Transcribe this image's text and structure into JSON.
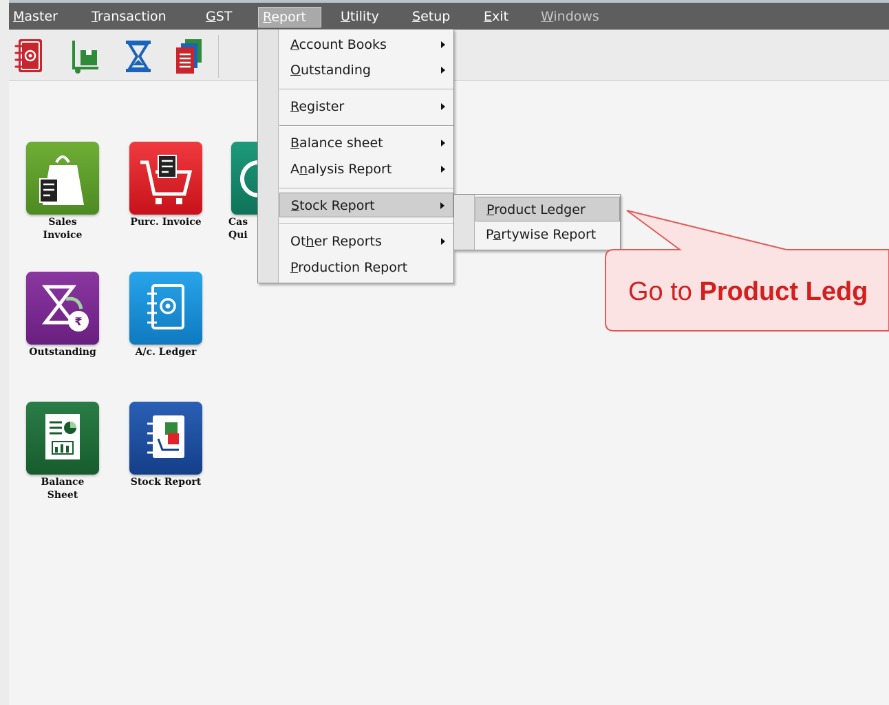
{
  "menubar": {
    "items": [
      {
        "label": "Master",
        "key": "M",
        "rest": "aster"
      },
      {
        "label": "Transaction",
        "key": "T",
        "rest": "ransaction"
      },
      {
        "label": "GST",
        "key": "G",
        "rest": "ST"
      },
      {
        "label": "Report",
        "key": "R",
        "rest": "eport"
      },
      {
        "label": "Utility",
        "key": "U",
        "rest": "tility"
      },
      {
        "label": "Setup",
        "key": "S",
        "rest": "etup"
      },
      {
        "label": "Exit",
        "key": "E",
        "rest": "xit"
      },
      {
        "label": "Windows",
        "key": "W",
        "rest": "indows"
      }
    ],
    "open_item": "Report"
  },
  "toolbar": {
    "icons": [
      "ledger-book-icon",
      "stock-trolley-icon",
      "hourglass-icon",
      "documents-icon"
    ]
  },
  "tiles": [
    {
      "label_line1": "Sales",
      "label_line2": "Invoice",
      "color": "#5b9a2c",
      "icon": "shopping-bag-icon"
    },
    {
      "label_line1": "Purc. Invoice",
      "label_line2": "",
      "color": "#e0232b",
      "icon": "shopping-cart-icon"
    },
    {
      "label_line1": "Cas",
      "label_line2": "Qui",
      "color": "#168a6e",
      "icon": "cash-icon"
    },
    {
      "label_line1": "Outstanding",
      "label_line2": "",
      "color": "#7a2b8e",
      "icon": "hourglass-rupee-icon"
    },
    {
      "label_line1": "A/c. Ledger",
      "label_line2": "",
      "color": "#1a8fd6",
      "icon": "ledger-book-icon"
    },
    {
      "label_line1": "Balance",
      "label_line2": "Sheet",
      "color": "#1f6a3a",
      "icon": "balance-sheet-icon"
    },
    {
      "label_line1": "Stock Report",
      "label_line2": "",
      "color": "#1c4fa0",
      "icon": "stock-report-icon"
    }
  ],
  "report_menu": {
    "items": [
      {
        "pre": "",
        "key": "A",
        "post": "ccount Books",
        "label": "Account Books",
        "has_submenu": true
      },
      {
        "pre": "",
        "key": "O",
        "post": "utstanding",
        "label": "Outstanding",
        "has_submenu": true
      },
      {
        "pre": "",
        "key": "R",
        "post": "egister",
        "label": "Register",
        "has_submenu": true
      },
      {
        "pre": "",
        "key": "B",
        "post": "alance sheet",
        "label": "Balance sheet",
        "has_submenu": true
      },
      {
        "pre": "A",
        "key": "n",
        "post": "alysis Report",
        "label": "Analysis Report",
        "has_submenu": true
      },
      {
        "pre": "",
        "key": "S",
        "post": "tock Report",
        "label": "Stock Report",
        "has_submenu": true
      },
      {
        "pre": "Ot",
        "key": "h",
        "post": "er Reports",
        "label": "Other Reports",
        "has_submenu": true
      },
      {
        "pre": "",
        "key": "P",
        "post": "roduction Report",
        "label": "Production Report",
        "has_submenu": false
      }
    ],
    "highlighted": "Stock Report"
  },
  "stock_submenu": {
    "items": [
      {
        "pre": "",
        "key": "P",
        "post": "roduct Ledger",
        "label": "Product Ledger"
      },
      {
        "pre": "P",
        "key": "a",
        "post": "rtywise Report",
        "label": "Partywise Report"
      }
    ],
    "highlighted": "Product Ledger"
  },
  "callout": {
    "prefix": "Go to ",
    "bold": "Product Ledg",
    "text_color": "#d21f1f",
    "fill_color": "#fbe3e3",
    "border_color": "#e05a5a"
  }
}
